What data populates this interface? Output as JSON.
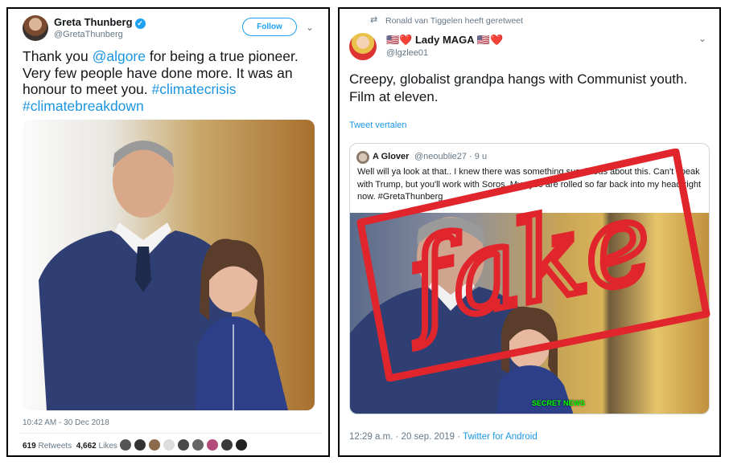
{
  "left_tweet": {
    "author_name": "Greta Thunberg",
    "verified_mark": "✓",
    "author_handle": "@GretaThunberg",
    "follow_label": "Follow",
    "menu_icon": "chevron-down-icon",
    "text_parts": [
      "Thank you ",
      "@algore",
      " for being a true pioneer. Very few people have done more. It was an honour to meet you. ",
      "#climatecrisis",
      " ",
      "#climatebreakdown"
    ],
    "timestamp": "10:42 AM - 30 Dec 2018",
    "retweet_count": "619",
    "retweet_label": "Retweets",
    "like_count": "4,662",
    "like_label": "Likes",
    "liker_avatar_colors": [
      "#555555",
      "#333333",
      "#8a6a4a",
      "#dddddd",
      "#4a4a4a",
      "#666666",
      "#b34a7a",
      "#3a3a3a",
      "#222222"
    ]
  },
  "right_tweet": {
    "retweet_context": "Ronald van Tiggelen heeft geretweet",
    "retweet_icon": "retweet-icon",
    "author_name": "🇺🇸❤️ Lady MAGA 🇺🇸❤️",
    "author_handle": "@lgzlee01",
    "menu_icon": "chevron-down-icon",
    "text": "Creepy, globalist grandpa hangs with Communist youth. Film at eleven.",
    "translate_label": "Tweet vertalen",
    "quote": {
      "author_name": "A Glover",
      "author_handle": "@neoublie27 · 9 u",
      "text": "Well will ya look at that.. I knew there was something suspicious about this. Can't speak with Trump, but you'll work with Soros. My eyes are rolled so far back into my head right now. #GretaThunberg",
      "photo_watermark": "SECRET NEWS"
    },
    "overlay_stamp_text": "fake",
    "timestamp_client": "12:29 a.m. · 20 sep. 2019 · ",
    "client": "Twitter for Android"
  },
  "colors": {
    "twitter_blue": "#1da1f2",
    "link_blue": "#1b95e0",
    "stamp_red": "#e0262c"
  }
}
